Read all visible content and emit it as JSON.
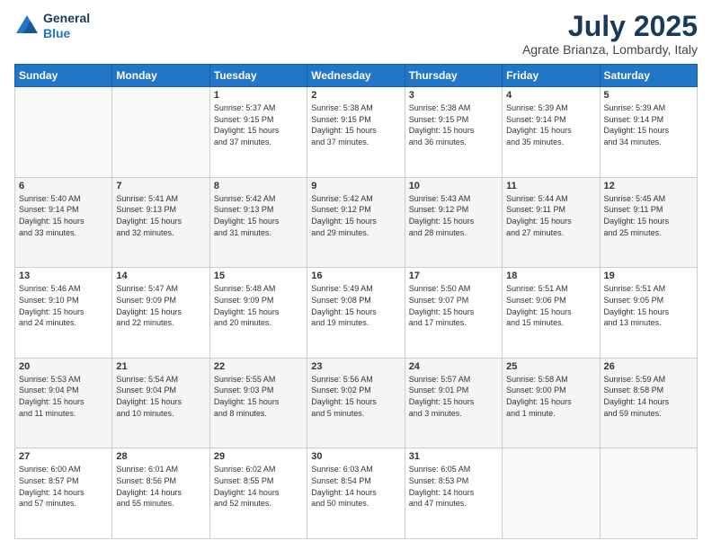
{
  "header": {
    "logo_line1": "General",
    "logo_line2": "Blue",
    "month": "July 2025",
    "location": "Agrate Brianza, Lombardy, Italy"
  },
  "days_of_week": [
    "Sunday",
    "Monday",
    "Tuesday",
    "Wednesday",
    "Thursday",
    "Friday",
    "Saturday"
  ],
  "weeks": [
    [
      {
        "day": "",
        "info": ""
      },
      {
        "day": "",
        "info": ""
      },
      {
        "day": "1",
        "info": "Sunrise: 5:37 AM\nSunset: 9:15 PM\nDaylight: 15 hours\nand 37 minutes."
      },
      {
        "day": "2",
        "info": "Sunrise: 5:38 AM\nSunset: 9:15 PM\nDaylight: 15 hours\nand 37 minutes."
      },
      {
        "day": "3",
        "info": "Sunrise: 5:38 AM\nSunset: 9:15 PM\nDaylight: 15 hours\nand 36 minutes."
      },
      {
        "day": "4",
        "info": "Sunrise: 5:39 AM\nSunset: 9:14 PM\nDaylight: 15 hours\nand 35 minutes."
      },
      {
        "day": "5",
        "info": "Sunrise: 5:39 AM\nSunset: 9:14 PM\nDaylight: 15 hours\nand 34 minutes."
      }
    ],
    [
      {
        "day": "6",
        "info": "Sunrise: 5:40 AM\nSunset: 9:14 PM\nDaylight: 15 hours\nand 33 minutes."
      },
      {
        "day": "7",
        "info": "Sunrise: 5:41 AM\nSunset: 9:13 PM\nDaylight: 15 hours\nand 32 minutes."
      },
      {
        "day": "8",
        "info": "Sunrise: 5:42 AM\nSunset: 9:13 PM\nDaylight: 15 hours\nand 31 minutes."
      },
      {
        "day": "9",
        "info": "Sunrise: 5:42 AM\nSunset: 9:12 PM\nDaylight: 15 hours\nand 29 minutes."
      },
      {
        "day": "10",
        "info": "Sunrise: 5:43 AM\nSunset: 9:12 PM\nDaylight: 15 hours\nand 28 minutes."
      },
      {
        "day": "11",
        "info": "Sunrise: 5:44 AM\nSunset: 9:11 PM\nDaylight: 15 hours\nand 27 minutes."
      },
      {
        "day": "12",
        "info": "Sunrise: 5:45 AM\nSunset: 9:11 PM\nDaylight: 15 hours\nand 25 minutes."
      }
    ],
    [
      {
        "day": "13",
        "info": "Sunrise: 5:46 AM\nSunset: 9:10 PM\nDaylight: 15 hours\nand 24 minutes."
      },
      {
        "day": "14",
        "info": "Sunrise: 5:47 AM\nSunset: 9:09 PM\nDaylight: 15 hours\nand 22 minutes."
      },
      {
        "day": "15",
        "info": "Sunrise: 5:48 AM\nSunset: 9:09 PM\nDaylight: 15 hours\nand 20 minutes."
      },
      {
        "day": "16",
        "info": "Sunrise: 5:49 AM\nSunset: 9:08 PM\nDaylight: 15 hours\nand 19 minutes."
      },
      {
        "day": "17",
        "info": "Sunrise: 5:50 AM\nSunset: 9:07 PM\nDaylight: 15 hours\nand 17 minutes."
      },
      {
        "day": "18",
        "info": "Sunrise: 5:51 AM\nSunset: 9:06 PM\nDaylight: 15 hours\nand 15 minutes."
      },
      {
        "day": "19",
        "info": "Sunrise: 5:51 AM\nSunset: 9:05 PM\nDaylight: 15 hours\nand 13 minutes."
      }
    ],
    [
      {
        "day": "20",
        "info": "Sunrise: 5:53 AM\nSunset: 9:04 PM\nDaylight: 15 hours\nand 11 minutes."
      },
      {
        "day": "21",
        "info": "Sunrise: 5:54 AM\nSunset: 9:04 PM\nDaylight: 15 hours\nand 10 minutes."
      },
      {
        "day": "22",
        "info": "Sunrise: 5:55 AM\nSunset: 9:03 PM\nDaylight: 15 hours\nand 8 minutes."
      },
      {
        "day": "23",
        "info": "Sunrise: 5:56 AM\nSunset: 9:02 PM\nDaylight: 15 hours\nand 5 minutes."
      },
      {
        "day": "24",
        "info": "Sunrise: 5:57 AM\nSunset: 9:01 PM\nDaylight: 15 hours\nand 3 minutes."
      },
      {
        "day": "25",
        "info": "Sunrise: 5:58 AM\nSunset: 9:00 PM\nDaylight: 15 hours\nand 1 minute."
      },
      {
        "day": "26",
        "info": "Sunrise: 5:59 AM\nSunset: 8:58 PM\nDaylight: 14 hours\nand 59 minutes."
      }
    ],
    [
      {
        "day": "27",
        "info": "Sunrise: 6:00 AM\nSunset: 8:57 PM\nDaylight: 14 hours\nand 57 minutes."
      },
      {
        "day": "28",
        "info": "Sunrise: 6:01 AM\nSunset: 8:56 PM\nDaylight: 14 hours\nand 55 minutes."
      },
      {
        "day": "29",
        "info": "Sunrise: 6:02 AM\nSunset: 8:55 PM\nDaylight: 14 hours\nand 52 minutes."
      },
      {
        "day": "30",
        "info": "Sunrise: 6:03 AM\nSunset: 8:54 PM\nDaylight: 14 hours\nand 50 minutes."
      },
      {
        "day": "31",
        "info": "Sunrise: 6:05 AM\nSunset: 8:53 PM\nDaylight: 14 hours\nand 47 minutes."
      },
      {
        "day": "",
        "info": ""
      },
      {
        "day": "",
        "info": ""
      }
    ]
  ]
}
